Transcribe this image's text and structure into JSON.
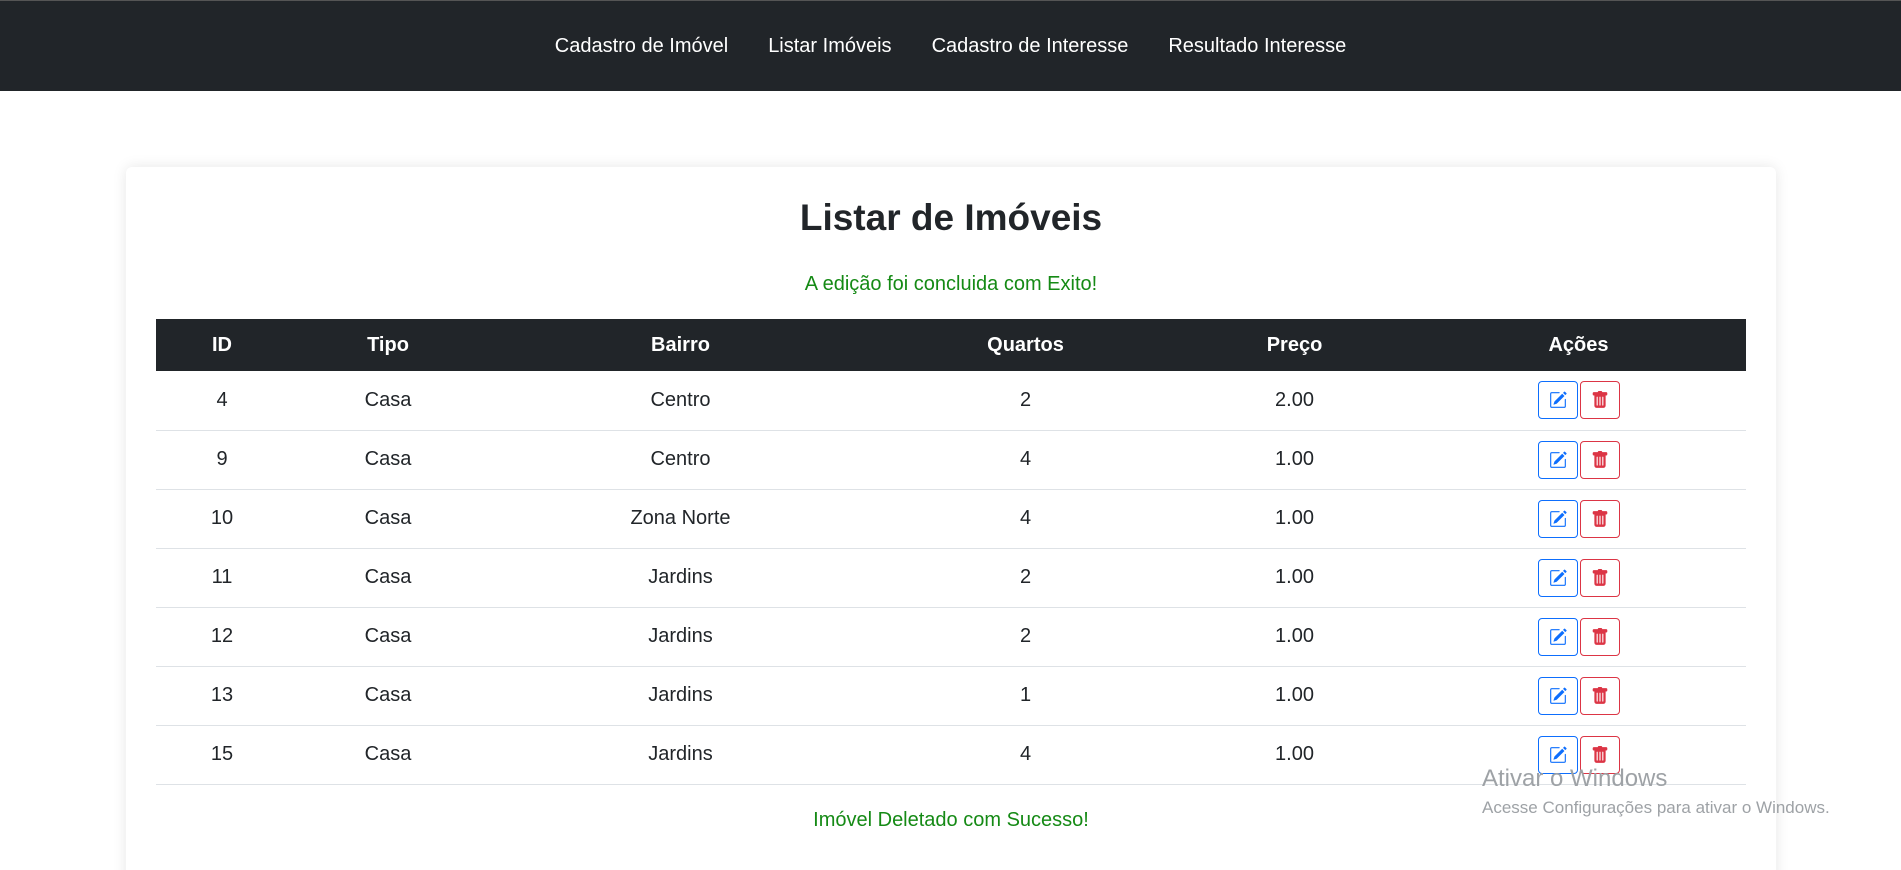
{
  "nav": {
    "items": [
      "Cadastro de Imóvel",
      "Listar Imóveis",
      "Cadastro de Interesse",
      "Resultado Interesse"
    ]
  },
  "page": {
    "title": "Listar de Imóveis",
    "success_message": "A edição foi concluida com Exito!",
    "delete_message": "Imóvel Deletado com Sucesso!"
  },
  "table": {
    "headers": [
      "ID",
      "Tipo",
      "Bairro",
      "Quartos",
      "Preço",
      "Ações"
    ],
    "rows": [
      [
        "4",
        "Casa",
        "Centro",
        "2",
        "2.00"
      ],
      [
        "9",
        "Casa",
        "Centro",
        "4",
        "1.00"
      ],
      [
        "10",
        "Casa",
        "Zona Norte",
        "4",
        "1.00"
      ],
      [
        "11",
        "Casa",
        "Jardins",
        "2",
        "1.00"
      ],
      [
        "12",
        "Casa",
        "Jardins",
        "2",
        "1.00"
      ],
      [
        "13",
        "Casa",
        "Jardins",
        "1",
        "1.00"
      ],
      [
        "15",
        "Casa",
        "Jardins",
        "4",
        "1.00"
      ]
    ],
    "action_icons": [
      "edit-icon",
      "trash-icon"
    ]
  },
  "watermark": {
    "title": "Ativar o Windows",
    "subtitle": "Acesse Configurações para ativar o Windows."
  },
  "colors": {
    "navbar": "#212529",
    "success_text": "#158a15",
    "edit_button": "#0d6efd",
    "delete_button": "#dc3545"
  }
}
